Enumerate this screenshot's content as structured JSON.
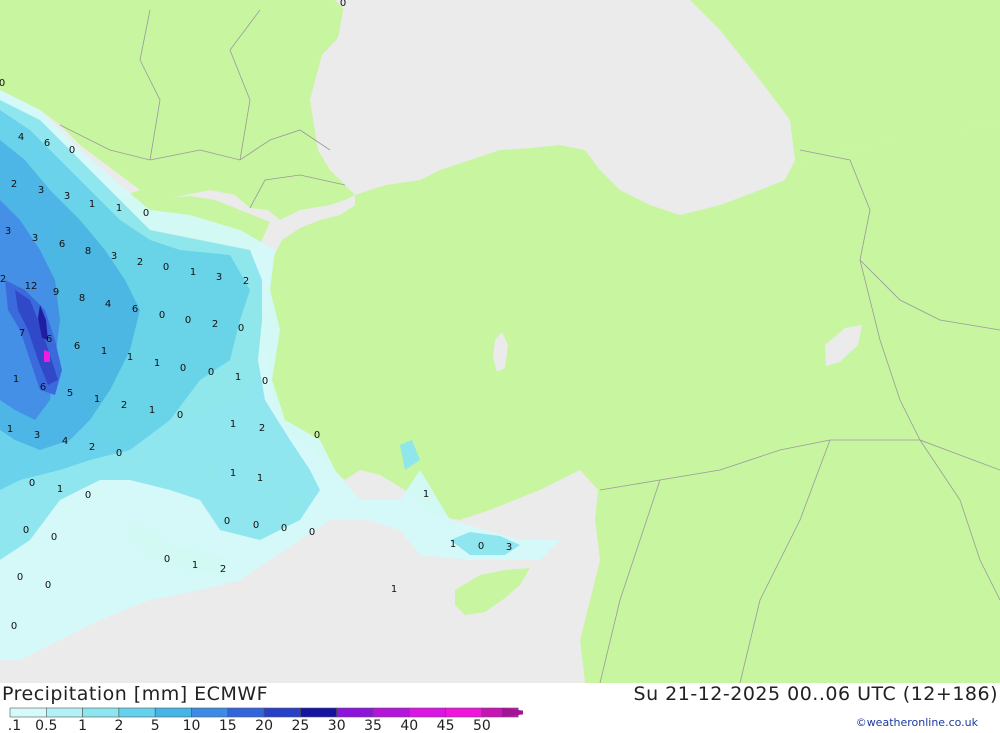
{
  "header": {
    "product": "Precipitation [mm] ECMWF",
    "valid_time": "Su 21-12-2025 00..06 UTC (12+186)"
  },
  "credit": "©weatheronline.co.uk",
  "legend": {
    "items": [
      {
        "label": "0.1",
        "color": "#d4fafa"
      },
      {
        "label": "0.5",
        "color": "#b4f0f5"
      },
      {
        "label": "1",
        "color": "#8ce6f0"
      },
      {
        "label": "2",
        "color": "#64d2ec"
      },
      {
        "label": "5",
        "color": "#46b4e6"
      },
      {
        "label": "10",
        "color": "#3c8ce6"
      },
      {
        "label": "15",
        "color": "#3264dc"
      },
      {
        "label": "20",
        "color": "#2840c8"
      },
      {
        "label": "25",
        "color": "#1414a0"
      },
      {
        "label": "30",
        "color": "#8c14dc"
      },
      {
        "label": "35",
        "color": "#b414dc"
      },
      {
        "label": "40",
        "color": "#dc14e6"
      },
      {
        "label": "45",
        "color": "#f014dc"
      },
      {
        "label": "50",
        "color": "#c814b4"
      }
    ],
    "arrow_color": "#a01496"
  },
  "colors": {
    "sea": "#ebebeb",
    "land": "#c8f5a0",
    "border": "#9a9a9a"
  },
  "point_values": [
    "0",
    "0",
    "4",
    "6",
    "0",
    "2",
    "3",
    "3",
    "1",
    "1",
    "0",
    "3",
    "3",
    "6",
    "8",
    "3",
    "2",
    "0",
    "1",
    "3",
    "2",
    "2",
    "12",
    "9",
    "8",
    "4",
    "6",
    "0",
    "0",
    "2",
    "0",
    "7",
    "6",
    "6",
    "1",
    "1",
    "1",
    "0",
    "0",
    "1",
    "0",
    "1",
    "6",
    "5",
    "1",
    "2",
    "1",
    "0",
    "1",
    "3",
    "4",
    "2",
    "0",
    "2",
    "0",
    "1",
    "1",
    "1",
    "0",
    "1",
    "0",
    "0",
    "0",
    "0",
    "0",
    "1",
    "0",
    "0",
    "1",
    "0",
    "3",
    "1",
    "0",
    "2",
    "1",
    "0",
    "0",
    "0"
  ]
}
